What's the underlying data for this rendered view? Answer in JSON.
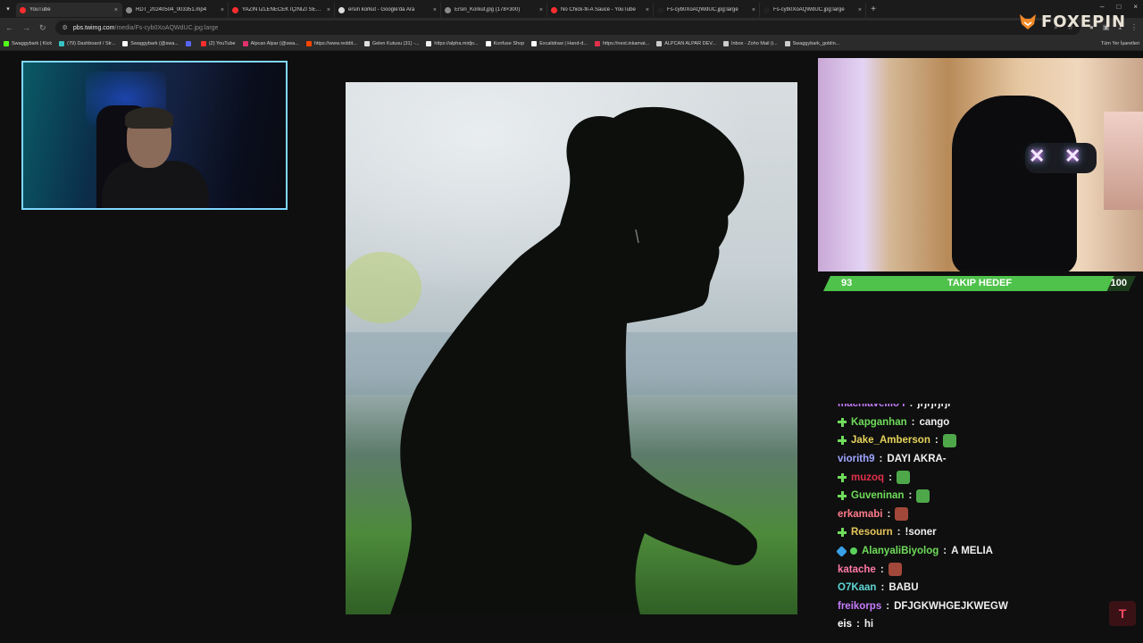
{
  "browser": {
    "tabs": [
      {
        "label": "YouTube",
        "color": "#ff2d2d",
        "active": true
      },
      {
        "label": "RDT_20240504_003351.mp4",
        "color": "#8a8a8a",
        "active": false
      },
      {
        "label": "YAZIN İZLENECEK İÇİNİZİ SERİSİ",
        "color": "#ff2d2d",
        "active": false
      },
      {
        "label": "ersin korkut - Google'da Ara",
        "color": "#dddddd",
        "active": false
      },
      {
        "label": "Ersin_Korkut.jpg (178×300)",
        "color": "#8a8a8a",
        "active": false
      },
      {
        "label": "No Chick-fil-A Sauce - YouTube",
        "color": "#ff2d2d",
        "active": false
      },
      {
        "label": "Fs-cyb0XoAQWdUC.jpg:large",
        "color": "#222222",
        "active": false
      },
      {
        "label": "Fs-cyb0XoAQWdUC.jpg:large",
        "color": "#222222",
        "active": false
      }
    ],
    "tab_close": "×",
    "new_tab": "+",
    "window_controls": [
      "–",
      "□",
      "×"
    ],
    "url_host": "pbs.twimg.com",
    "url_path": "/media/Fs-cyb0XoAQWdUC.jpg:large",
    "bookmarks": [
      {
        "label": "Swaggybark | Kick",
        "color": "#53fc18"
      },
      {
        "label": "(79) Dashboard / Str...",
        "color": "#35c3c3"
      },
      {
        "label": "Swaggybark (@swa...",
        "color": "#ffffff"
      },
      {
        "label": "",
        "color": "#5865f2"
      },
      {
        "label": "(2) YouTube",
        "color": "#ff2d2d"
      },
      {
        "label": "Alpcan Alpar (@swa...",
        "color": "#e1306c"
      },
      {
        "label": "https://www.reddit...",
        "color": "#ff4500"
      },
      {
        "label": "Gelen Kutusu (31) -...",
        "color": "#dddddd"
      },
      {
        "label": "https://alpha.midjo...",
        "color": "#eeeeee"
      },
      {
        "label": "Konfuse Shop",
        "color": "#ffffff"
      },
      {
        "label": "Excalidraw | Hand-d...",
        "color": "#ffffff"
      },
      {
        "label": "https://next.inkamat...",
        "color": "#e0304a"
      },
      {
        "label": "ALPCAN ALPAR DEV...",
        "color": "#cccccc"
      },
      {
        "label": "Inbox - Zoho Mail (i...",
        "color": "#cccccc"
      },
      {
        "label": "Swaggybark_goblin...",
        "color": "#cccccc"
      }
    ],
    "bookmarks_other": "Tüm Yer İşaretleri"
  },
  "logo": {
    "text": "FOXEPIN"
  },
  "goal": {
    "start": "93",
    "title": "TAKIP HEDEF",
    "end": "100",
    "progress": 0.93
  },
  "chat": {
    "lines": [
      {
        "user": "machiavellio i",
        "color": "#c77dff",
        "badges": [],
        "msg": "jrjrjrjrjr",
        "emote": null
      },
      {
        "user": "Kapganhan",
        "color": "#6fdc5b",
        "badges": [
          "mod"
        ],
        "msg": "cango",
        "emote": null
      },
      {
        "user": "Jake_Amberson",
        "color": "#e6d35b",
        "badges": [
          "mod"
        ],
        "msg": "",
        "emote": "green"
      },
      {
        "user": "viorith9",
        "color": "#9fa6ff",
        "badges": [],
        "msg": "DAYI AKRA-",
        "emote": null
      },
      {
        "user": "muzoq",
        "color": "#e0304a",
        "badges": [
          "mod"
        ],
        "msg": "",
        "emote": "green"
      },
      {
        "user": "Guveninan",
        "color": "#6fdc5b",
        "badges": [
          "mod"
        ],
        "msg": "",
        "emote": "green"
      },
      {
        "user": "erkamabi",
        "color": "#ff7a8a",
        "badges": [],
        "msg": "",
        "emote": "red"
      },
      {
        "user": "Resourn",
        "color": "#e6c65b",
        "badges": [
          "mod"
        ],
        "msg": "!soner",
        "emote": null
      },
      {
        "user": "AlanyaliBiyolog",
        "color": "#6fdc5b",
        "badges": [
          "gem",
          "green"
        ],
        "msg": "A MELIA",
        "emote": null
      },
      {
        "user": "katache",
        "color": "#ff7aa8",
        "badges": [],
        "msg": "",
        "emote": "red"
      },
      {
        "user": "O7Kaan",
        "color": "#5fd6d6",
        "badges": [],
        "msg": "BABU",
        "emote": null
      },
      {
        "user": "freikorps",
        "color": "#c77dff",
        "badges": [],
        "msg": "DFJGKWHGEJKWEGW",
        "emote": null
      },
      {
        "user": "eis",
        "color": "#ffffff",
        "badges": [],
        "msg": "hi",
        "emote": null
      }
    ],
    "separator": " : "
  },
  "corner_icon": "T"
}
